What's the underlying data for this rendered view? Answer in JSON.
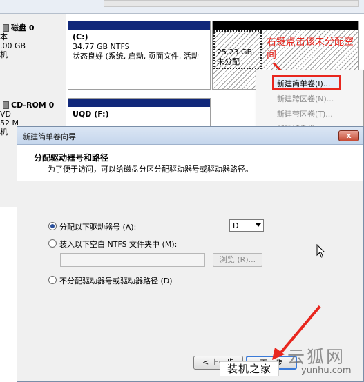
{
  "disk_mgmt": {
    "disk0": {
      "name": "磁盘 0",
      "type": "本",
      "size": ".00 GB",
      "status": "机"
    },
    "partition_c": {
      "label": "(C:)",
      "size_fs": "34.77 GB NTFS",
      "status": "状态良好 (系统, 启动, 页面文件, 活动"
    },
    "unallocated": {
      "size": "25.23 GB",
      "status": "未分配"
    },
    "cdrom0": {
      "name": "CD-ROM 0",
      "type": "VD",
      "size": "52 M",
      "status": "机"
    },
    "partition_f": {
      "label": "UQD  (F:)"
    }
  },
  "annotation": {
    "text": "右键点击该未分配空间"
  },
  "context_menu": {
    "items": [
      "新建简单卷(I)...",
      "新建跨区卷(N)...",
      "新建带区卷(T)...",
      "新建镜像卷"
    ]
  },
  "wizard": {
    "title": "新建简单卷向导",
    "close_label": "x",
    "heading": "分配驱动器号和路径",
    "subheading": "为了便于访问，可以给磁盘分区分配驱动器号或驱动器路径。",
    "option_assign": "分配以下驱动器号 (A):",
    "drive_letter": "D",
    "option_mount": "装入以下空白 NTFS 文件夹中 (M):",
    "browse_label": "浏览 (R)...",
    "option_none": "不分配驱动器号或驱动器路径 (D)",
    "back_label": "< 上一步",
    "next_label": "下一步"
  },
  "watermark": {
    "site_cn": "装机之家",
    "brand": "云狐网",
    "url": "yunhu.com"
  },
  "colors": {
    "accent": "#e8261e",
    "partition_bar": "#11287a",
    "unallocated_bar": "#000000"
  }
}
